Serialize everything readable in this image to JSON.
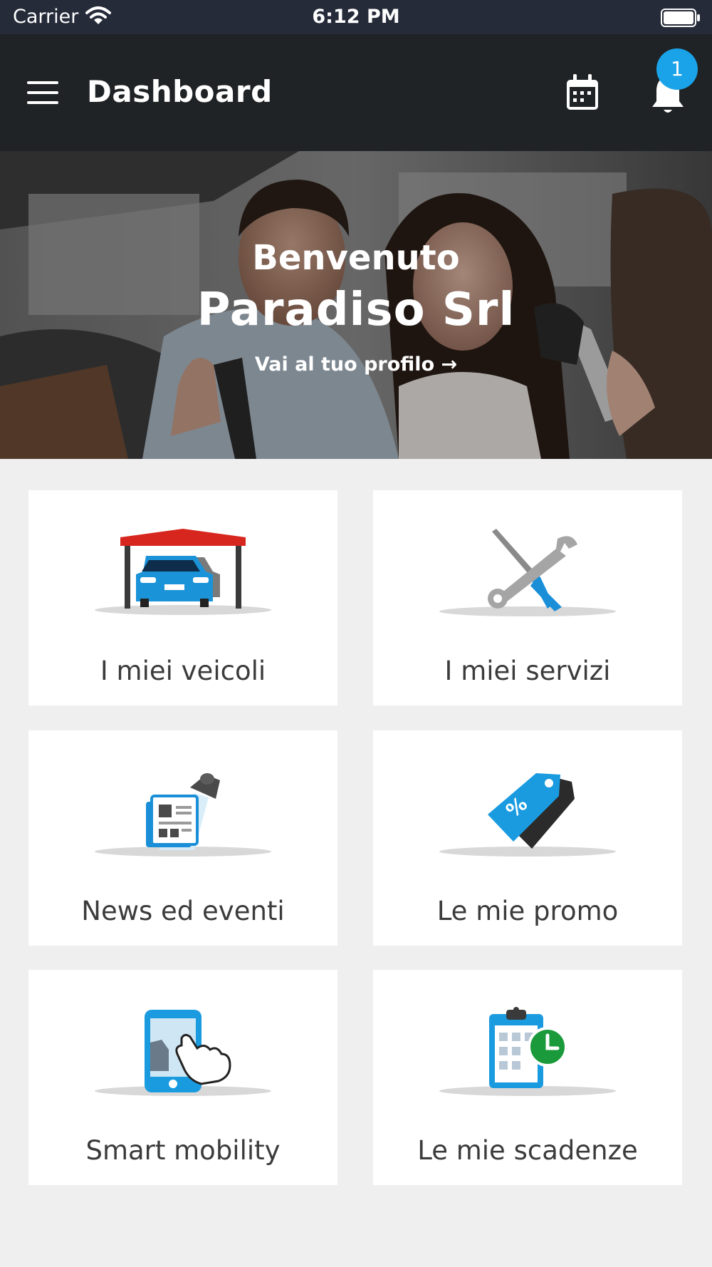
{
  "status_bar": {
    "carrier": "Carrier",
    "time": "6:12 PM"
  },
  "app_bar": {
    "title": "Dashboard",
    "notification_count": "1"
  },
  "hero": {
    "welcome": "Benvenuto",
    "company": "Paradiso Srl",
    "profile_link": "Vai al tuo profilo →"
  },
  "tiles": [
    {
      "label": "I miei veicoli",
      "icon": "garage-car-icon"
    },
    {
      "label": "I miei servizi",
      "icon": "tools-icon"
    },
    {
      "label": "News ed eventi",
      "icon": "news-spotlight-icon"
    },
    {
      "label": "Le mie promo",
      "icon": "promo-tag-icon"
    },
    {
      "label": "Smart mobility",
      "icon": "smartphone-touch-icon"
    },
    {
      "label": "Le mie scadenze",
      "icon": "clipboard-clock-icon"
    }
  ],
  "colors": {
    "status_bar": "#262b3a",
    "app_bar": "#1f2326",
    "accent": "#1aa3e8",
    "background": "#efefef",
    "tile_text": "#3b3b3b"
  }
}
